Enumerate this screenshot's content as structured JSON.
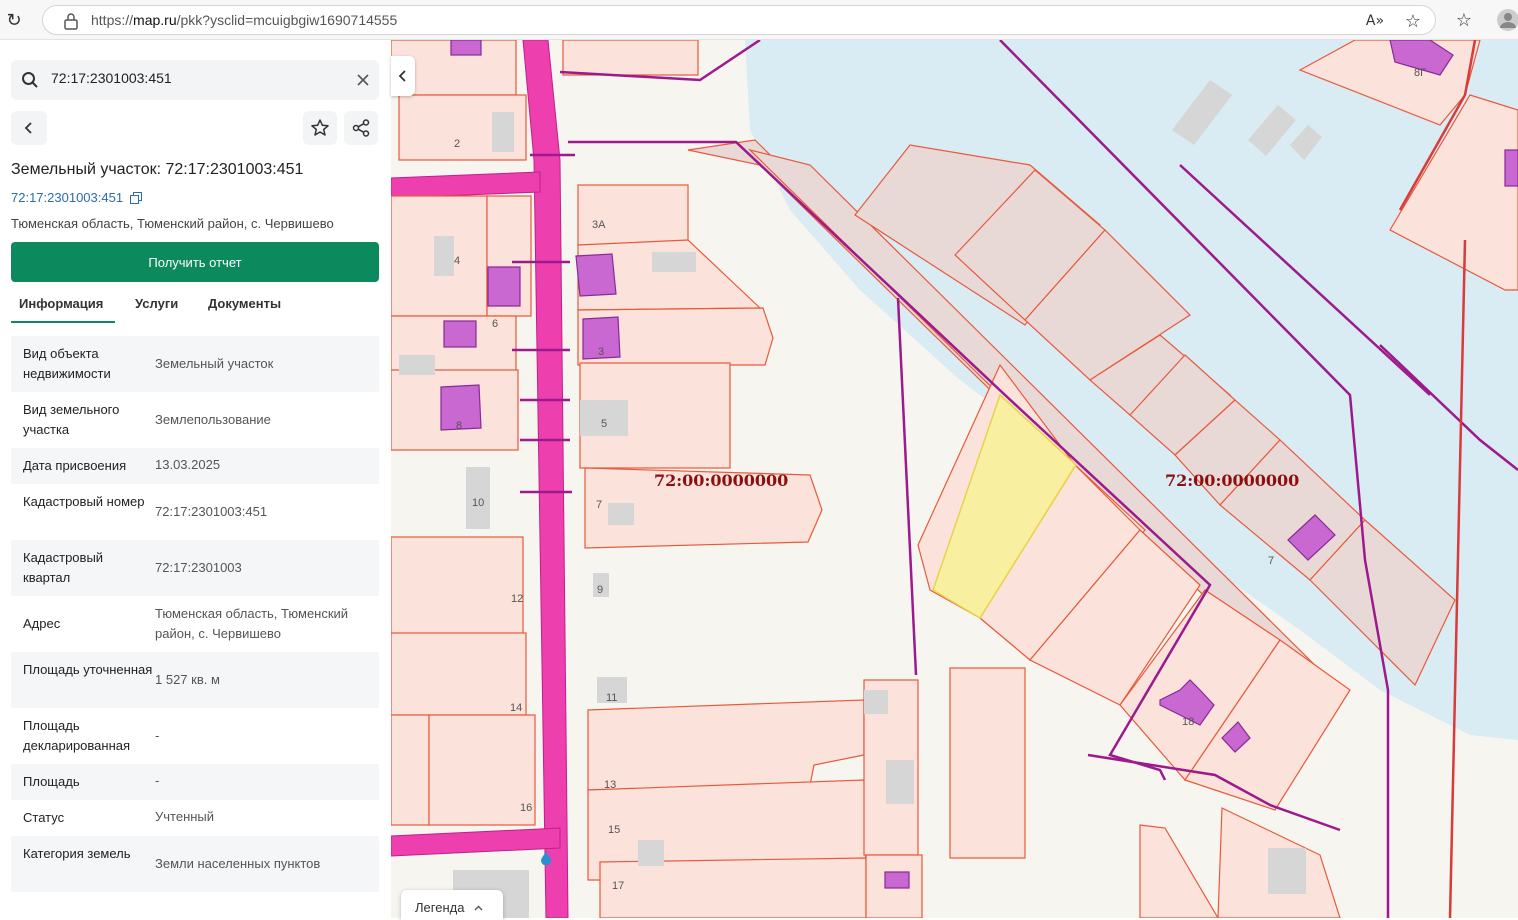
{
  "browser": {
    "url_prefix": "https://",
    "url_host": "map.ru",
    "url_path": "/pkk?ysclid=mcuigbgiw1690714555"
  },
  "sidebar": {
    "search_value": "72:17:2301003:451",
    "title": "Земельный участок: 72:17:2301003:451",
    "cadastral_link": "72:17:2301003:451",
    "address_line": "Тюменская область, Тюменский район, с. Червишево",
    "report_button": "Получить отчет",
    "tabs": [
      {
        "label": "Информация"
      },
      {
        "label": "Услуги"
      },
      {
        "label": "Документы"
      }
    ],
    "properties": [
      {
        "key": "Вид объекта недвижимости",
        "value": "Земельный участок"
      },
      {
        "key": "Вид земельного участка",
        "value": "Землепользование"
      },
      {
        "key": "Дата присвоения",
        "value": "13.03.2025"
      },
      {
        "key": "Кадастровый номер",
        "value": "72:17:2301003:451"
      },
      {
        "key": "Кадастровый квартал",
        "value": "72:17:2301003"
      },
      {
        "key": "Адрес",
        "value": "Тюменская область, Тюменский район, с. Червишево"
      },
      {
        "key": "Площадь уточненная",
        "value": "1 527 кв. м"
      },
      {
        "key": "Площадь декларированная",
        "value": "-"
      },
      {
        "key": "Площадь",
        "value": "-"
      },
      {
        "key": "Статус",
        "value": "Учтенный"
      },
      {
        "key": "Категория земель",
        "value": "Земли населенных пунктов"
      }
    ]
  },
  "map": {
    "quarter_labels": [
      "72:00:0000000",
      "72:00:0000000"
    ],
    "house_numbers": [
      "2",
      "3А",
      "4",
      "6",
      "3",
      "8",
      "5",
      "10",
      "7",
      "12",
      "9",
      "14",
      "11",
      "16",
      "13",
      "15",
      "17",
      "18",
      "7",
      "8Г"
    ],
    "legend_label": "Легенда",
    "colors": {
      "parcel_border": "#e8593c",
      "parcel_fill": "#fbe3dc",
      "zone_border": "#9c1a8c",
      "road": "#ee3fae",
      "water": "#d9ebf3",
      "selected_fill": "#f7f09a",
      "building": "#c968d1",
      "accent_green": "#0c8a5e"
    }
  }
}
